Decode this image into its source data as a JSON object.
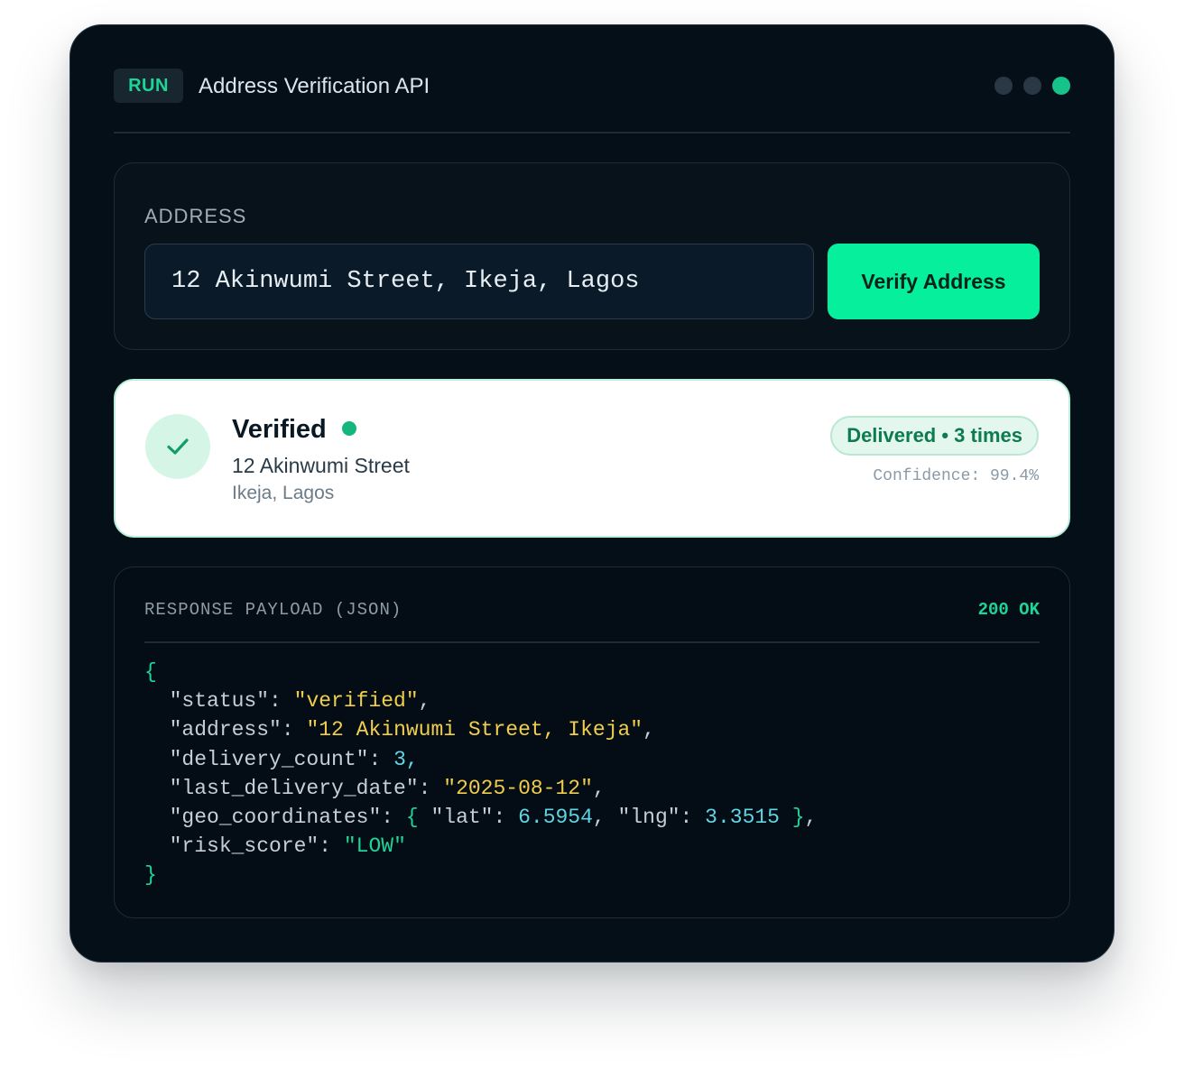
{
  "header": {
    "badge": "RUN",
    "title": "Address Verification API",
    "window_dots": [
      "gray",
      "gray",
      "green"
    ],
    "colors": {
      "accent": "#05ef9c",
      "background": "#050f18"
    }
  },
  "address_form": {
    "label": "ADDRESS",
    "input_value": "12 Akinwumi Street, Ikeja, Lagos",
    "button_label": "Verify Address"
  },
  "result": {
    "status": "Verified",
    "street": "12 Akinwumi Street",
    "city": "Ikeja, Lagos",
    "delivered_badge": "Delivered • 3 times",
    "confidence": "Confidence: 99.4%"
  },
  "payload": {
    "label": "RESPONSE PAYLOAD (JSON)",
    "http_status": "200 OK",
    "open_brace": "{",
    "close_brace": "}",
    "fields": {
      "status_key": "\"status\"",
      "status_value": "\"verified\"",
      "address_key": "\"address\"",
      "address_value": "\"12 Akinwumi Street, Ikeja\"",
      "delivery_count_key": "\"delivery_count\"",
      "delivery_count_value": "3",
      "last_delivery_date_key": "\"last_delivery_date\"",
      "last_delivery_date_value": "\"2025-08-12\"",
      "geo_key": "\"geo_coordinates\"",
      "lat_key": "\"lat\"",
      "lat_value": "6.5954",
      "lng_key": "\"lng\"",
      "lng_value": "3.3515",
      "risk_key": "\"risk_score\"",
      "risk_value": "\"LOW\""
    }
  }
}
